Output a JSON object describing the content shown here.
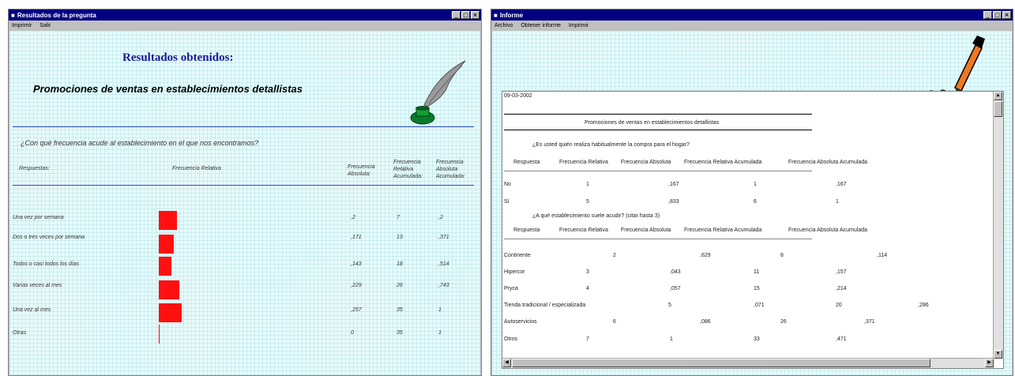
{
  "left_window": {
    "title": "Resultados de la pregunta",
    "menu": [
      "Imprimir",
      "Salir"
    ],
    "heading": "Resultados obtenidos:",
    "subheading": "Promociones de ventas en establecimientos detallistas",
    "question": "¿Con qué frecuencia acude al establecimiento en el que nos encontramos?",
    "columns": {
      "respuestas": "Respuestas:",
      "frec_relativa": "Frecuencia Relativa",
      "frec_absoluta": [
        "Frecuencia",
        "Absoluta:"
      ],
      "frec_rel_acum": [
        "Frecuencia",
        "Relativa",
        "Acumulada:"
      ],
      "frec_abs_acum": [
        "Frecuencia",
        "Absoluta",
        "Acumulada:"
      ]
    },
    "rows": [
      {
        "label": "Una vez por semana",
        "abs": ",2",
        "rel_acum": "7",
        "abs_acum": ",2",
        "bar": 0.2
      },
      {
        "label": "Dos o tres veces por semana",
        "abs": ",171",
        "rel_acum": "13",
        "abs_acum": ",371",
        "bar": 0.171
      },
      {
        "label": "Todos o casi todos los días",
        "abs": ",143",
        "rel_acum": "18",
        "abs_acum": ",514",
        "bar": 0.143
      },
      {
        "label": "Varias veces al mes",
        "abs": ",229",
        "rel_acum": "26",
        "abs_acum": ",743",
        "bar": 0.229
      },
      {
        "label": "Una vez al mes",
        "abs": ",257",
        "rel_acum": "35",
        "abs_acum": "1",
        "bar": 0.257
      },
      {
        "label": "Otras",
        "abs": "0",
        "rel_acum": "35",
        "abs_acum": "1",
        "bar": 0
      }
    ]
  },
  "right_window": {
    "title": "Informe",
    "menu": [
      "Archivo",
      "Obtener informe",
      "Imprimir"
    ],
    "date": "09-03-2002",
    "report_title": "Promociones de ventas en establecimientos detallistas",
    "q1": {
      "question": "¿Es usted quién realiza habitualmente la compra para el hogar?",
      "headers": [
        "Respuesta",
        "Frecuencia Relativa",
        "Frecuencia Absoluta",
        "Frecuencia Relativa Acumulada",
        "Frecuencia Absoluta Acumulada"
      ],
      "rows": [
        [
          "No",
          "1",
          ",167",
          "1",
          ",167"
        ],
        [
          "Sí",
          "5",
          ",833",
          "6",
          "1"
        ]
      ]
    },
    "q2": {
      "question": "¿A qué establecimiento suele acudir? (citar hasta 3)",
      "headers": [
        "Respuesta",
        "Frecuencia Relativa",
        "Frecuencia Absoluta",
        "Frecuencia Relativa Acumulada",
        "Frecuencia Absoluta Acumulada"
      ],
      "rows": [
        [
          "Continente",
          "2",
          ",629",
          "8",
          ",114"
        ],
        [
          "Hipercor",
          "3",
          ",043",
          "11",
          ",157"
        ],
        [
          "Pryca",
          "4",
          ",057",
          "15",
          ",214"
        ],
        [
          "Tienda tradicional / especializada",
          "5",
          ",071",
          "20",
          ",286"
        ],
        [
          "Autoservicios",
          "6",
          ",086",
          "26",
          ",371"
        ],
        [
          "Otros",
          "7",
          "1",
          "33",
          ",471"
        ]
      ]
    }
  },
  "colors": {
    "title_bar": "#000080",
    "bar": "#ff1010",
    "heading": "#1a1a9a",
    "divider": "#3050c0"
  },
  "icons": [
    "quill-inkwell-icon",
    "pen-icon"
  ]
}
